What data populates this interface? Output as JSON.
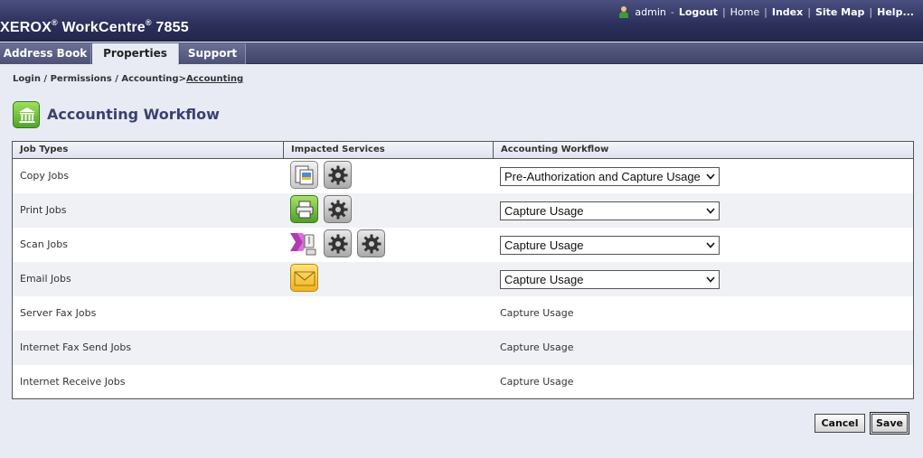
{
  "header": {
    "brand": "XEROX",
    "product": "WorkCentre",
    "model": "7855",
    "reg_mark": "®",
    "user": "admin",
    "links": [
      "Logout",
      "Home",
      "Index",
      "Site Map",
      "Help..."
    ],
    "separator_dash": "-",
    "separator": "|"
  },
  "tabs": [
    {
      "label": "Address Book",
      "active": false
    },
    {
      "label": "Properties",
      "active": true
    },
    {
      "label": "Support",
      "active": false
    }
  ],
  "breadcrumb": {
    "items": [
      "Login",
      "Permissions",
      "Accounting"
    ],
    "separator": " / ",
    "current_separator": ">",
    "current": "Accounting"
  },
  "page": {
    "title": "Accounting Workflow",
    "icon": "bank-icon"
  },
  "table": {
    "headers": [
      "Job Types",
      "Impacted Services",
      "Accounting Workflow"
    ],
    "rows": [
      {
        "job": "Copy Jobs",
        "services": [
          "copy-icon",
          "gear-icon"
        ],
        "workflow": "Pre-Authorization and Capture Usage",
        "editable": true
      },
      {
        "job": "Print Jobs",
        "services": [
          "print-icon",
          "gear-icon"
        ],
        "workflow": "Capture Usage",
        "editable": true
      },
      {
        "job": "Scan Jobs",
        "services": [
          "scan-icon",
          "gear-icon",
          "gear-icon"
        ],
        "workflow": "Capture Usage",
        "editable": true
      },
      {
        "job": "Email Jobs",
        "services": [
          "email-icon"
        ],
        "workflow": "Capture Usage",
        "editable": true
      },
      {
        "job": "Server Fax Jobs",
        "services": [],
        "workflow": "Capture Usage",
        "editable": false
      },
      {
        "job": "Internet Fax Send Jobs",
        "services": [],
        "workflow": "Capture Usage",
        "editable": false
      },
      {
        "job": "Internet Receive Jobs",
        "services": [],
        "workflow": "Capture Usage",
        "editable": false
      }
    ]
  },
  "buttons": {
    "cancel": "Cancel",
    "save": "Save"
  },
  "colors": {
    "header_bg": "#2b2f5a",
    "page_bg": "#e8ebf4",
    "title": "#3a4170",
    "accent_green": "#4fa52a"
  }
}
